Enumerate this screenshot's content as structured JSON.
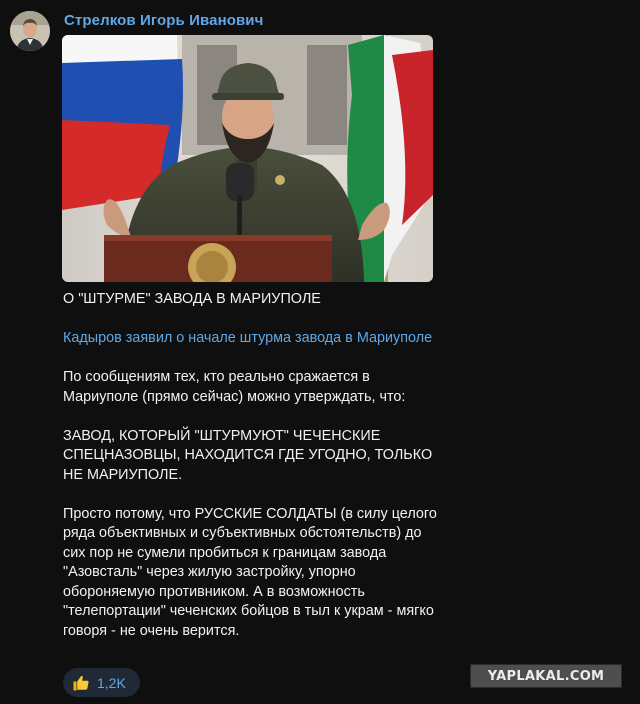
{
  "channel": {
    "name": "Стрелков Игорь Иванович"
  },
  "post": {
    "heading": "О \"ШТУРМЕ\" ЗАВОДА В МАРИУПОЛЕ",
    "link_text": "Кадыров заявил о начале штурма завода в Мариуполе",
    "paragraph1": "По сообщениям тех, кто реально сражается в Мариуполе (прямо сейчас) можно утверждать, что:",
    "paragraph2": "ЗАВОД, КОТОРЫЙ \"ШТУРМУЮТ\" ЧЕЧЕНСКИЕ СПЕЦНАЗОВЦЫ, НАХОДИТСЯ ГДЕ УГОДНО, ТОЛЬКО НЕ МАРИУПОЛЕ.",
    "paragraph3": "Просто потому, что РУССКИЕ СОЛДАТЫ (в силу целого ряда объективных и субъективных обстоятельств) до сих пор не сумели пробиться к границам завода \"Азовсталь\" через жилую застройку, упорно обороняемую противником. А в возможность \"телепортации\" чеченских бойцов в тыл к украм - мягко говоря - не очень верится."
  },
  "reaction": {
    "icon": "thumbs-up-icon",
    "count": "1,2K"
  },
  "watermark": {
    "text": "YAPLAKAL.COM"
  },
  "colors": {
    "background": "#0f0f0f",
    "accent": "#5fa8e8",
    "text": "#f2f2f2"
  }
}
